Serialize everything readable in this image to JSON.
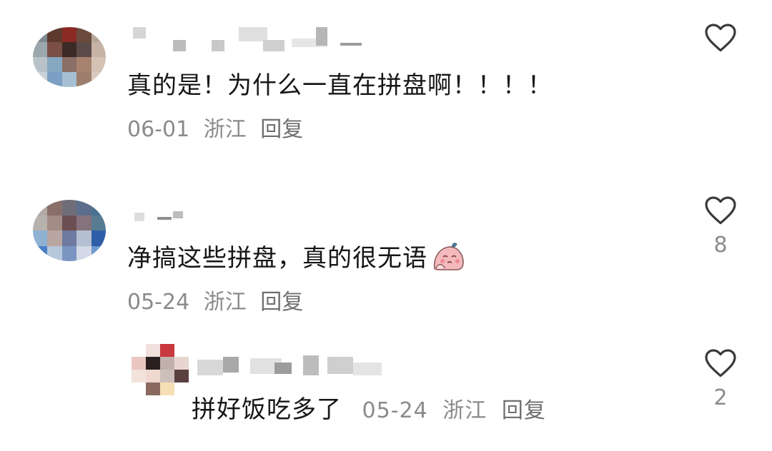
{
  "comments": [
    {
      "text": "真的是！为什么一直在拼盘啊！！！！",
      "date": "06-01",
      "location": "浙江",
      "reply_label": "回复",
      "like_count": ""
    },
    {
      "text": "净搞这些拼盘，真的很无语",
      "emoji": "sighing-face-emoji",
      "date": "05-24",
      "location": "浙江",
      "reply_label": "回复",
      "like_count": "8"
    },
    {
      "text": "拼好饭吃多了",
      "date": "05-24",
      "location": "浙江",
      "reply_label": "回复",
      "like_count": "2",
      "is_reply": true
    }
  ],
  "icons": {
    "like": "heart-outline-icon"
  },
  "colors": {
    "text": "#161616",
    "meta": "#8b8b8b",
    "icon": "#3a3a3a"
  }
}
